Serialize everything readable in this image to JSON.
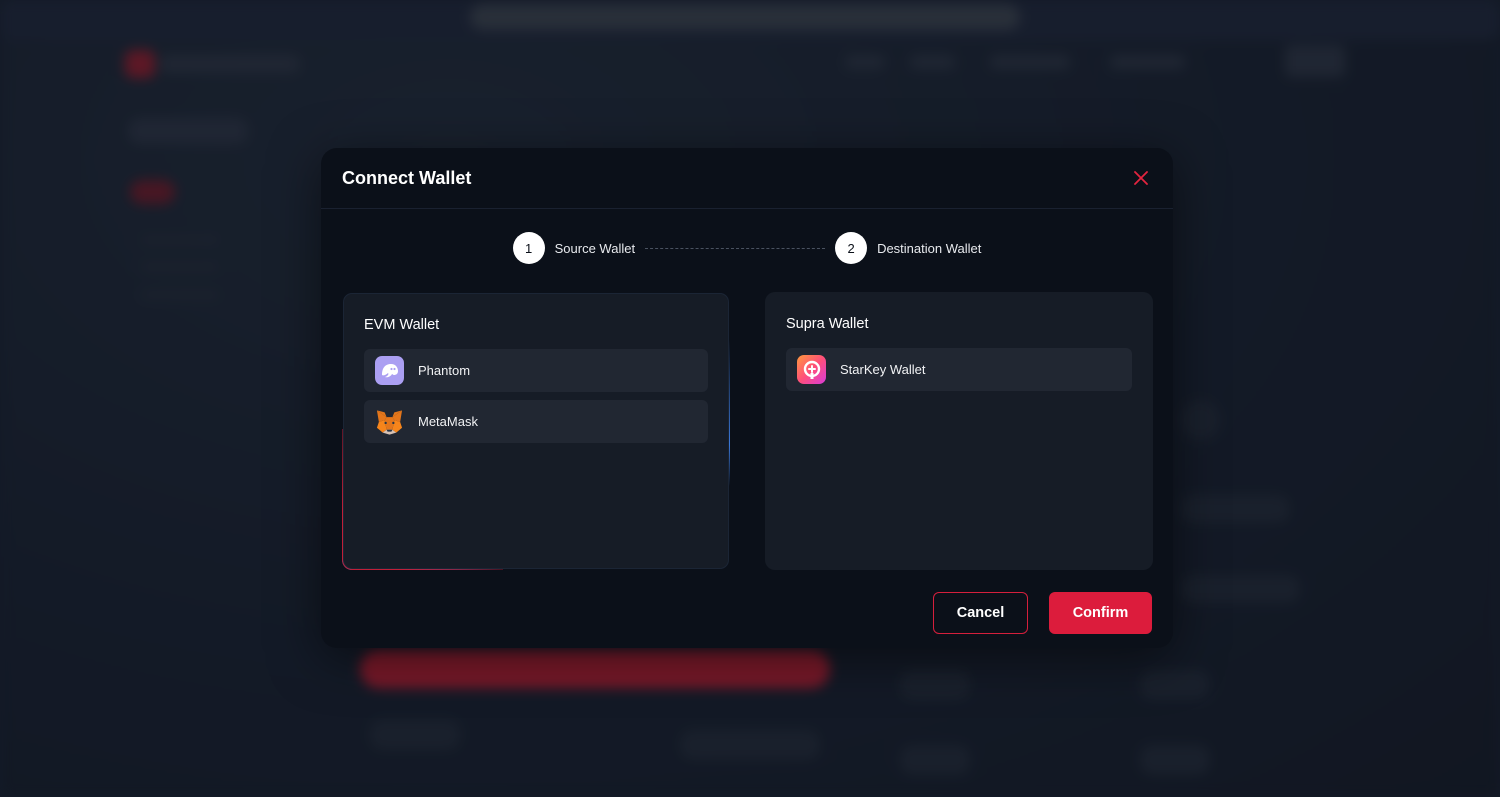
{
  "modal": {
    "title": "Connect Wallet",
    "close_icon": "close-icon",
    "steps": [
      {
        "number": "1",
        "label": "Source Wallet"
      },
      {
        "number": "2",
        "label": "Destination Wallet"
      }
    ],
    "evm_panel": {
      "title": "EVM Wallet",
      "wallets": [
        {
          "name": "Phantom",
          "icon": "phantom-icon"
        },
        {
          "name": "MetaMask",
          "icon": "metamask-icon"
        }
      ]
    },
    "supra_panel": {
      "title": "Supra Wallet",
      "wallets": [
        {
          "name": "StarKey Wallet",
          "icon": "starkey-icon"
        }
      ]
    },
    "buttons": {
      "cancel": "Cancel",
      "confirm": "Confirm"
    }
  },
  "colors": {
    "accent": "#dc1c3c",
    "modal_bg": "#0b1019",
    "panel_bg": "#161c26",
    "item_bg": "#212732"
  }
}
